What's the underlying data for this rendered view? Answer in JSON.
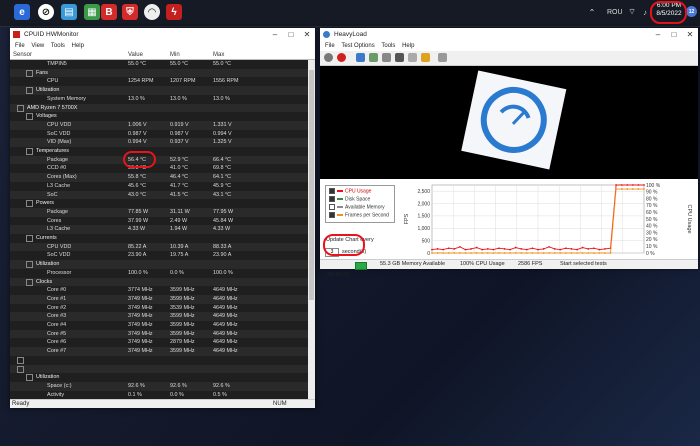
{
  "taskbar": {
    "lang": "ROU",
    "clock_time": "6:00 PM",
    "clock_date": "8/5/2022",
    "notification_count": "12"
  },
  "hwmonitor": {
    "title": "CPUID HWMonitor",
    "menu": [
      "File",
      "View",
      "Tools",
      "Help"
    ],
    "columns": [
      "Sensor",
      "Value",
      "Min",
      "Max"
    ],
    "status": "Ready",
    "status_right": "NUM",
    "rows": [
      {
        "name": "TMPIN5",
        "indent": 3,
        "value": "55.0 °C",
        "min": "55.0 °C",
        "max": "55.0 °C"
      },
      {
        "name": "Fans",
        "indent": 2,
        "cat": true
      },
      {
        "name": "CPU",
        "indent": 3,
        "value": "1254 RPM",
        "min": "1207 RPM",
        "max": "1556 RPM"
      },
      {
        "name": "Utilization",
        "indent": 2,
        "cat": true
      },
      {
        "name": "System Memory",
        "indent": 3,
        "value": "13.0 %",
        "min": "13.0 %",
        "max": "13.0 %"
      },
      {
        "name": "AMD Ryzen 7 5700X",
        "indent": 1,
        "cat": true
      },
      {
        "name": "Voltages",
        "indent": 2,
        "cat": true
      },
      {
        "name": "CPU VDD",
        "indent": 3,
        "value": "1.006 V",
        "min": "0.919 V",
        "max": "1.331 V"
      },
      {
        "name": "SoC VDD",
        "indent": 3,
        "value": "0.987 V",
        "min": "0.987 V",
        "max": "0.994 V"
      },
      {
        "name": "VID (Max)",
        "indent": 3,
        "value": "0.994 V",
        "min": "0.937 V",
        "max": "1.325 V"
      },
      {
        "name": "Temperatures",
        "indent": 2,
        "cat": true
      },
      {
        "name": "Package",
        "indent": 3,
        "value": "56.4 °C",
        "min": "52.9 °C",
        "max": "66.4 °C"
      },
      {
        "name": "CCD #0",
        "indent": 3,
        "value": "56.3 °C",
        "min": "41.0 °C",
        "max": "69.8 °C"
      },
      {
        "name": "Cores (Max)",
        "indent": 3,
        "value": "55.8 °C",
        "min": "46.4 °C",
        "max": "64.1 °C"
      },
      {
        "name": "L3 Cache",
        "indent": 3,
        "value": "45.6 °C",
        "min": "41.7 °C",
        "max": "45.9 °C"
      },
      {
        "name": "SoC",
        "indent": 3,
        "value": "43.0 °C",
        "min": "41.5 °C",
        "max": "43.1 °C"
      },
      {
        "name": "Powers",
        "indent": 2,
        "cat": true
      },
      {
        "name": "Package",
        "indent": 3,
        "value": "77.85 W",
        "min": "31.11 W",
        "max": "77.95 W"
      },
      {
        "name": "Cores",
        "indent": 3,
        "value": "37.99 W",
        "min": "2.49 W",
        "max": "45.84 W"
      },
      {
        "name": "L3 Cache",
        "indent": 3,
        "value": "4.33 W",
        "min": "1.94 W",
        "max": "4.33 W"
      },
      {
        "name": "Currents",
        "indent": 2,
        "cat": true
      },
      {
        "name": "CPU VDD",
        "indent": 3,
        "value": "85.22 A",
        "min": "10.39 A",
        "max": "88.33 A"
      },
      {
        "name": "SoC VDD",
        "indent": 3,
        "value": "23.90 A",
        "min": "19.75 A",
        "max": "23.90 A"
      },
      {
        "name": "Utilization",
        "indent": 2,
        "cat": true
      },
      {
        "name": "Processor",
        "indent": 3,
        "value": "100.0 %",
        "min": "0.0 %",
        "max": "100.0 %"
      },
      {
        "name": "Clocks",
        "indent": 2,
        "cat": true
      },
      {
        "name": "Core #0",
        "indent": 3,
        "value": "3774 MHz",
        "min": "3599 MHz",
        "max": "4649 MHz"
      },
      {
        "name": "Core #1",
        "indent": 3,
        "value": "3749 MHz",
        "min": "3599 MHz",
        "max": "4649 MHz"
      },
      {
        "name": "Core #2",
        "indent": 3,
        "value": "3749 MHz",
        "min": "3539 MHz",
        "max": "4649 MHz"
      },
      {
        "name": "Core #3",
        "indent": 3,
        "value": "3749 MHz",
        "min": "3599 MHz",
        "max": "4649 MHz"
      },
      {
        "name": "Core #4",
        "indent": 3,
        "value": "3749 MHz",
        "min": "3599 MHz",
        "max": "4649 MHz"
      },
      {
        "name": "Core #5",
        "indent": 3,
        "value": "3749 MHz",
        "min": "3599 MHz",
        "max": "4649 MHz"
      },
      {
        "name": "Core #6",
        "indent": 3,
        "value": "3749 MHz",
        "min": "2879 MHz",
        "max": "4649 MHz"
      },
      {
        "name": "Core #7",
        "indent": 3,
        "value": "3749 MHz",
        "min": "3599 MHz",
        "max": "4649 MHz"
      },
      {
        "name": "",
        "indent": 1,
        "cat": true
      },
      {
        "name": "",
        "indent": 1,
        "cat": true
      },
      {
        "name": "Utilization",
        "indent": 2,
        "cat": true
      },
      {
        "name": "Space (c:)",
        "indent": 3,
        "value": "92.6 %",
        "min": "92.6 %",
        "max": "92.6 %"
      },
      {
        "name": "Activity",
        "indent": 3,
        "value": "0.1 %",
        "min": "0.0 %",
        "max": "0.5 %"
      },
      {
        "name": "Speed",
        "indent": 2,
        "cat": true
      }
    ]
  },
  "heavyload": {
    "title": "HeavyLoad",
    "menu": [
      "File",
      "Test Options",
      "Tools",
      "Help"
    ],
    "legend": [
      {
        "label": "CPU Usage",
        "color": "#e8141b",
        "checked": true
      },
      {
        "label": "Disk Space",
        "color": "#3a8a3a",
        "checked": true
      },
      {
        "label": "Available Memory",
        "color": "#8a8a8a",
        "checked": false
      },
      {
        "label": "Frames per Second",
        "color": "#f09020",
        "checked": true
      }
    ],
    "update_label": "Update Chart every",
    "update_value": "3",
    "update_unit": "second(s)",
    "runtime_label": "Test runtime:",
    "runtime_value": "00:00:20",
    "status": {
      "memory": "55.3 GB Memory Available",
      "cpu": "100% CPU Usage",
      "fps": "2586 FPS",
      "action": "Start selected tests"
    }
  },
  "chart_data": {
    "type": "line",
    "left_axis_label": "FPS",
    "right_axis_label": "CPU Usage",
    "left_ticks": [
      "2,500",
      "2,000",
      "1,500",
      "1,000",
      "500",
      "0"
    ],
    "right_ticks": [
      "100 %",
      "90 %",
      "80 %",
      "70 %",
      "60 %",
      "50 %",
      "40 %",
      "30 %",
      "20 %",
      "10 %",
      "0 %"
    ],
    "ylim_left": [
      0,
      2750
    ],
    "ylim_right": [
      0,
      100
    ],
    "series": [
      {
        "name": "CPU Usage",
        "color": "#e8141b",
        "values": [
          5,
          6,
          5,
          7,
          6,
          9,
          5,
          6,
          8,
          5,
          6,
          5,
          7,
          6,
          5,
          8,
          6,
          5,
          7,
          5,
          6,
          9,
          6,
          5,
          7,
          6,
          5,
          8,
          6,
          7,
          5,
          6,
          7,
          100,
          100,
          100,
          100,
          100,
          100
        ]
      },
      {
        "name": "Frames per Second",
        "color": "#f09020",
        "values": [
          0,
          0,
          0,
          0,
          0,
          0,
          0,
          0,
          0,
          0,
          0,
          0,
          0,
          0,
          0,
          0,
          0,
          0,
          0,
          0,
          0,
          0,
          0,
          0,
          0,
          0,
          0,
          0,
          0,
          0,
          0,
          0,
          0,
          2586,
          2586,
          2586,
          2586,
          2586,
          2586
        ]
      }
    ]
  }
}
